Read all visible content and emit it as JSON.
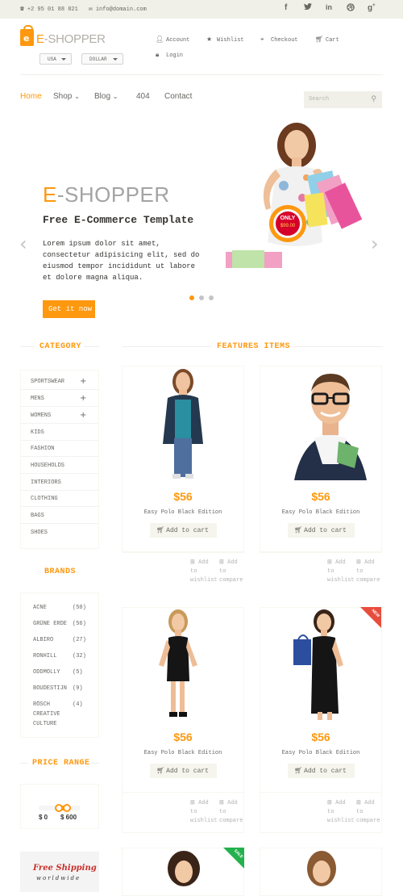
{
  "topbar": {
    "phone": "+2 95 01 88 821",
    "email": "info@domain.com",
    "social": [
      "facebook-icon",
      "twitter-icon",
      "linkedin-icon",
      "dribbble-icon",
      "google-plus-icon"
    ]
  },
  "header": {
    "logo_text_e": "E",
    "logo_text_rest": "-SHOPPER",
    "logo_bag_letter": "e",
    "country": "USA",
    "currency": "DOLLAR",
    "links": {
      "account": "Account",
      "wishlist": "Wishlist",
      "checkout": "Checkout",
      "cart": "Cart",
      "login": "Login"
    }
  },
  "nav": {
    "items": [
      {
        "label": "Home",
        "active": true
      },
      {
        "label": "Shop",
        "active": false
      },
      {
        "label": "Blog",
        "active": false
      },
      {
        "label": "404",
        "active": false
      },
      {
        "label": "Contact",
        "active": false
      }
    ],
    "search_placeholder": "Search"
  },
  "slider": {
    "title_e": "E",
    "title_rest": "-SHOPPER",
    "subtitle": "Free E-Commerce Template",
    "text": "Lorem ipsum dolor sit amet, consectetur adipisicing elit, sed do eiusmod tempor incididunt ut labore et dolore magna aliqua.",
    "button": "Get it now",
    "badge_top": "ONLY",
    "badge_price": "$99.00",
    "active_slide": 1,
    "slides": 3
  },
  "sidebar": {
    "category_title": "CATEGORY",
    "categories": [
      {
        "label": "SPORTSWEAR",
        "expandable": true
      },
      {
        "label": "MENS",
        "expandable": true
      },
      {
        "label": "WOMENS",
        "expandable": true
      },
      {
        "label": "KIDS",
        "expandable": false
      },
      {
        "label": "FASHION",
        "expandable": false
      },
      {
        "label": "HOUSEHOLDS",
        "expandable": false
      },
      {
        "label": "INTERIORS",
        "expandable": false
      },
      {
        "label": "CLOTHING",
        "expandable": false
      },
      {
        "label": "BAGS",
        "expandable": false
      },
      {
        "label": "SHOES",
        "expandable": false
      }
    ],
    "brands_title": "BRANDS",
    "brands": [
      {
        "name": "ACNE",
        "count": "(50)"
      },
      {
        "name": "GRÜNE ERDE",
        "count": "(56)"
      },
      {
        "name": "ALBIRO",
        "count": "(27)"
      },
      {
        "name": "RONHILL",
        "count": "(32)"
      },
      {
        "name": "ODDMOLLY",
        "count": "(5)"
      },
      {
        "name": "BOUDESTIJN",
        "count": "(9)"
      },
      {
        "name": "RÖSCH CREATIVE CULTURE",
        "count": "(4)"
      }
    ],
    "price_title": "PRICE RANGE",
    "price_min": "$ 0",
    "price_max": "$ 600",
    "shipping_line1": "Free Shipping",
    "shipping_line2": "worldwide"
  },
  "features": {
    "title": "FEATURES ITEMS",
    "products": [
      {
        "price": "$56",
        "name": "Easy Polo Black Edition",
        "cart": "Add to cart",
        "wishlist": "Add to wishlist",
        "compare": "Add to compare",
        "badge": ""
      },
      {
        "price": "$56",
        "name": "Easy Polo Black Edition",
        "cart": "Add to cart",
        "wishlist": "Add to wishlist",
        "compare": "Add to compare",
        "badge": ""
      },
      {
        "price": "$56",
        "name": "Easy Polo Black Edition",
        "cart": "Add to cart",
        "wishlist": "Add to wishlist",
        "compare": "Add to compare",
        "badge": ""
      },
      {
        "price": "$56",
        "name": "Easy Polo Black Edition",
        "cart": "Add to cart",
        "wishlist": "Add to wishlist",
        "compare": "Add to compare",
        "badge": "NEW"
      },
      {
        "price": "",
        "name": "",
        "cart": "",
        "wishlist": "",
        "compare": "",
        "badge": "SALE"
      },
      {
        "price": "",
        "name": "",
        "cart": "",
        "wishlist": "",
        "compare": "",
        "badge": ""
      }
    ]
  },
  "colors": {
    "accent": "#fe980f",
    "text": "#696763",
    "dark": "#363432",
    "bar": "#f0f0e9",
    "new": "#e84c3d",
    "sale": "#23b14d"
  }
}
